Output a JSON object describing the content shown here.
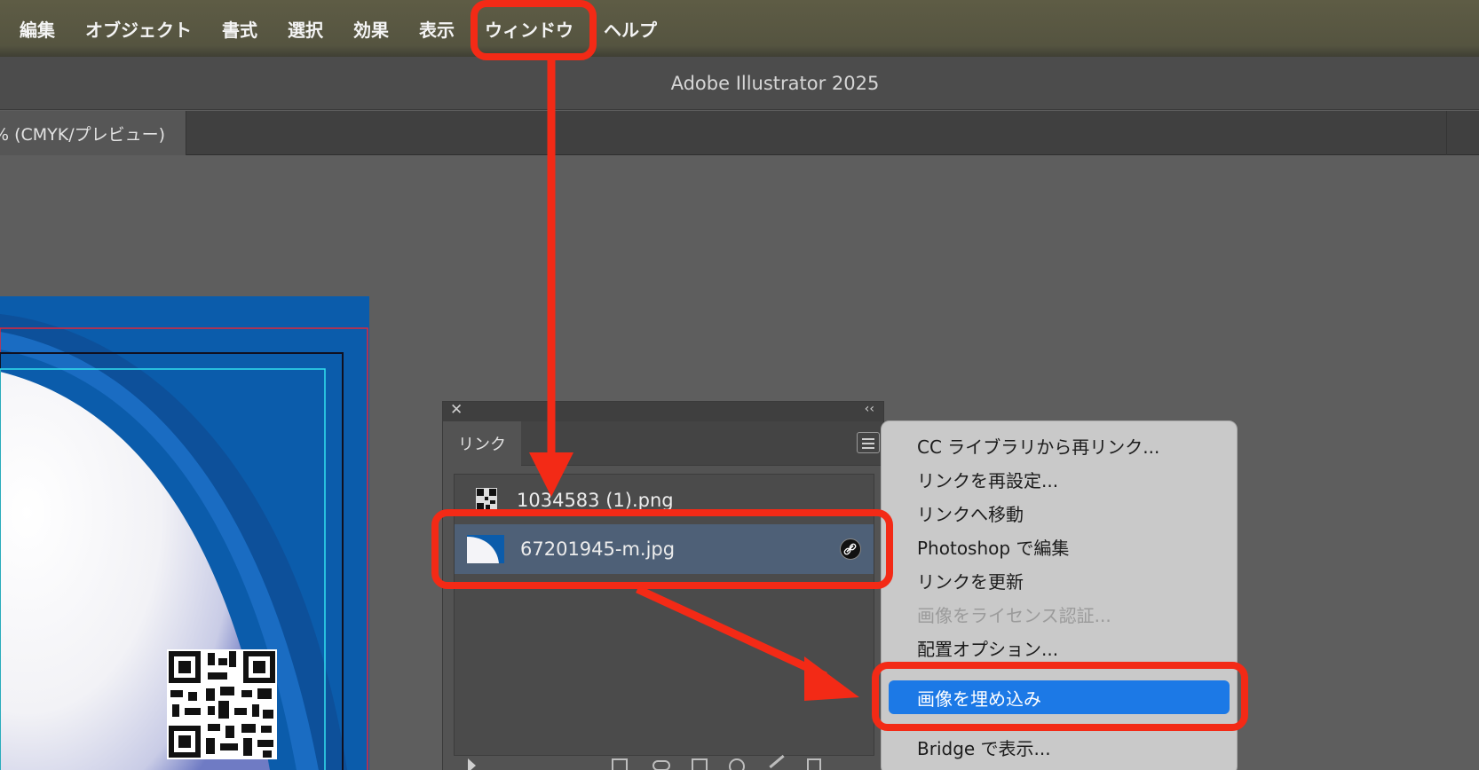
{
  "menubar": {
    "items": [
      "編集",
      "オブジェクト",
      "書式",
      "選択",
      "効果",
      "表示",
      "ウィンドウ",
      "ヘルプ"
    ]
  },
  "window": {
    "title": "Adobe Illustrator 2025"
  },
  "document_tab": {
    "label": "% (CMYK/プレビュー)"
  },
  "links_panel": {
    "tab_label": "リンク",
    "items": [
      {
        "name": "1034583 (1).png",
        "selected": false
      },
      {
        "name": "67201945-m.jpg",
        "selected": true
      }
    ]
  },
  "context_menu": {
    "items": [
      {
        "label": "CC ライブラリから再リンク...",
        "enabled": true
      },
      {
        "label": "リンクを再設定...",
        "enabled": true
      },
      {
        "label": "リンクへ移動",
        "enabled": true
      },
      {
        "label": "Photoshop で編集",
        "enabled": true
      },
      {
        "label": "リンクを更新",
        "enabled": true
      },
      {
        "label": "画像をライセンス認証...",
        "enabled": false
      },
      {
        "label": "配置オプション...",
        "enabled": true
      },
      {
        "label": "画像を埋め込み",
        "enabled": true,
        "highlighted": true
      },
      {
        "label": "Bridge で表示...",
        "enabled": true
      }
    ]
  },
  "colors": {
    "annotation_red": "#f32a16",
    "menu_highlight": "#1c79e6",
    "selected_row": "#4e6077",
    "artboard_blue": "#0a5aa8"
  }
}
